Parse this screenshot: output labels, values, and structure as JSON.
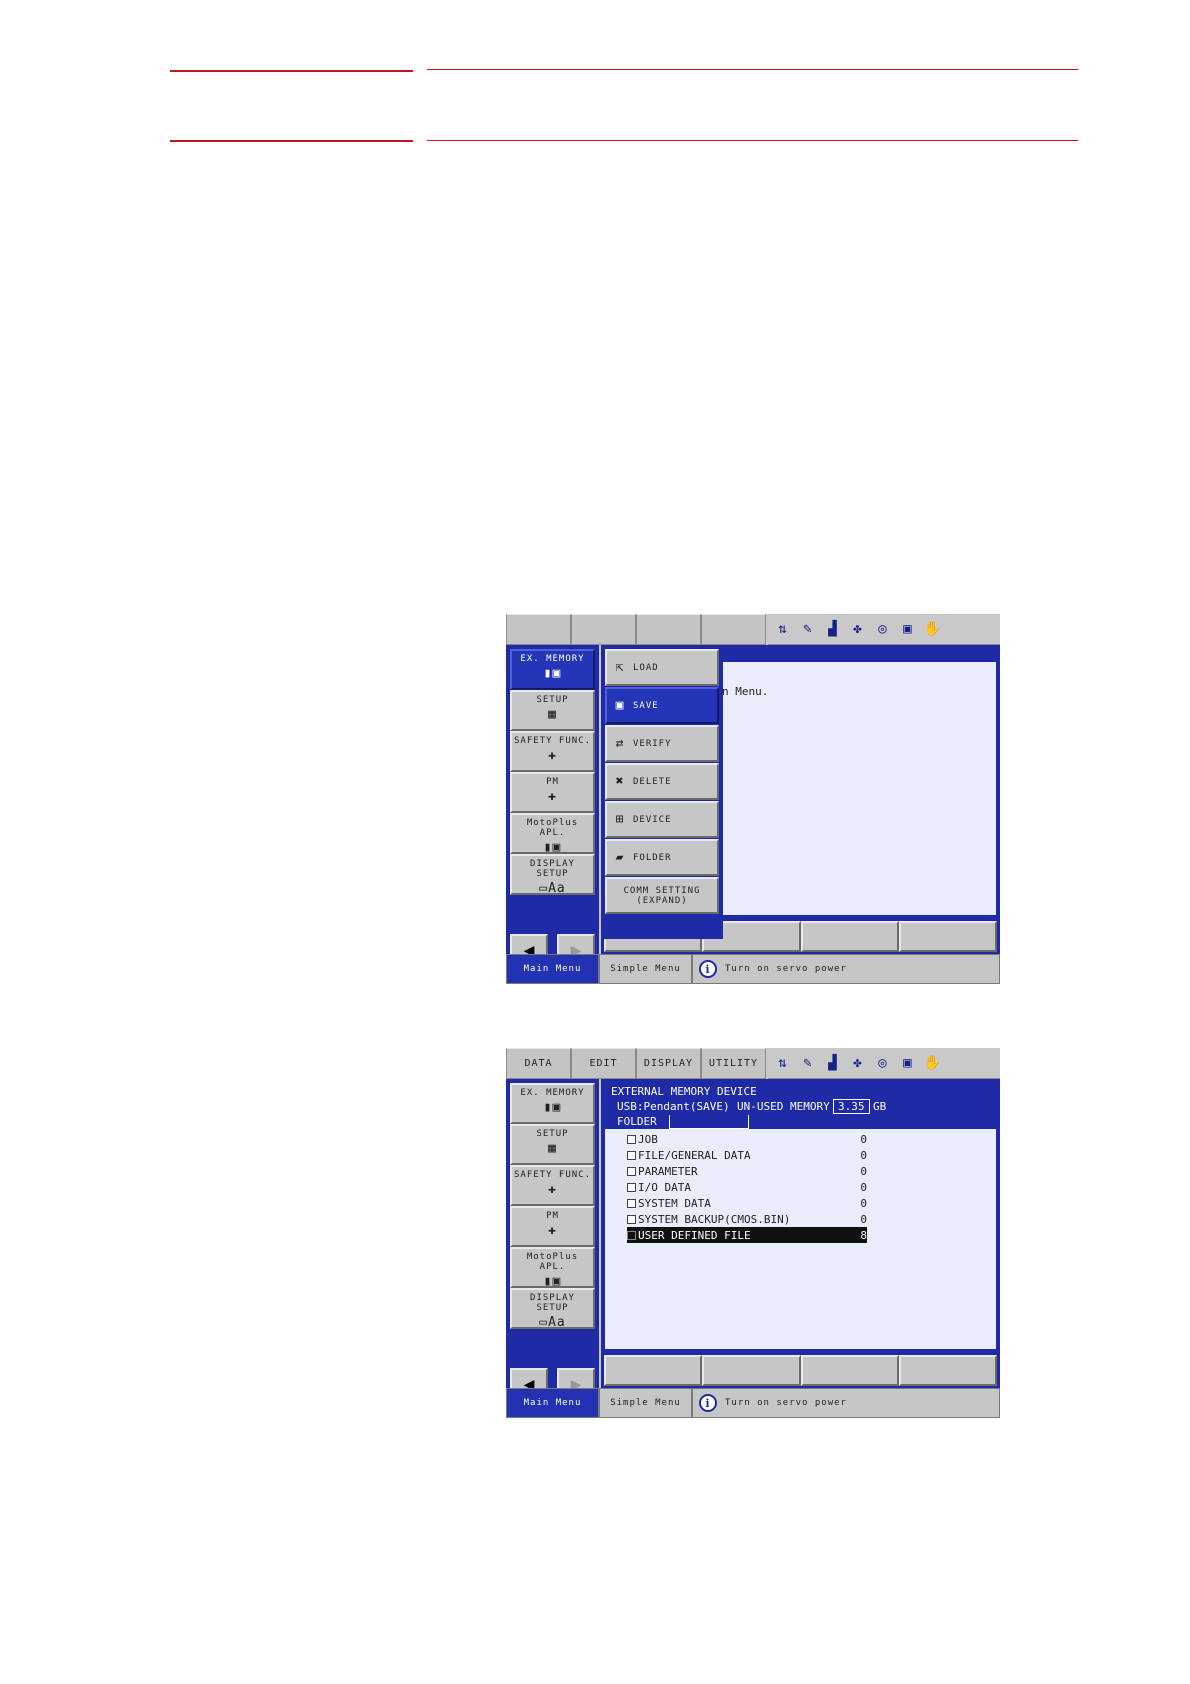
{
  "screens": [
    {
      "tabs": [
        "",
        "",
        "",
        ""
      ],
      "main_menu": [
        {
          "label": "EX. MEMORY",
          "icon": "sd-card-icon",
          "glyph": "▮▣",
          "active": true
        },
        {
          "label": "SETUP",
          "icon": "setup-icon",
          "glyph": "▦",
          "active": false
        },
        {
          "label": "SAFETY FUNC.",
          "icon": "safety-icon",
          "glyph": "✚",
          "active": false
        },
        {
          "label": "PM",
          "icon": "first-aid-kit-icon",
          "glyph": "✚",
          "active": false
        },
        {
          "label": "MotoPlus APL.",
          "icon": "sd-card-icon",
          "glyph": "▮▣",
          "active": false
        },
        {
          "label": "DISPLAY SETUP",
          "icon": "display-setup-icon",
          "glyph": "▭Aa",
          "active": false
        }
      ],
      "submenu": [
        {
          "label": "LOAD",
          "icon": "load-icon",
          "glyph": "⇱",
          "active": false
        },
        {
          "label": "SAVE",
          "icon": "save-icon",
          "glyph": "▣",
          "active": true
        },
        {
          "label": "VERIFY",
          "icon": "verify-icon",
          "glyph": "⇄",
          "active": false
        },
        {
          "label": "DELETE",
          "icon": "delete-icon",
          "glyph": "✖",
          "active": false
        },
        {
          "label": "DEVICE",
          "icon": "device-icon",
          "glyph": "⊞",
          "active": false
        },
        {
          "label": "FOLDER",
          "icon": "folder-icon",
          "glyph": "▰",
          "active": false
        },
        {
          "label": "COMM SETTING",
          "label2": "(EXPAND)",
          "icon": "",
          "glyph": "",
          "active": false
        }
      ],
      "hint": "n Menu."
    },
    {
      "tabs": [
        "DATA",
        "EDIT",
        "DISPLAY",
        "UTILITY"
      ],
      "main_menu": [
        {
          "label": "EX. MEMORY",
          "icon": "sd-card-icon",
          "glyph": "▮▣",
          "active": false
        },
        {
          "label": "SETUP",
          "icon": "setup-icon",
          "glyph": "▦",
          "active": false
        },
        {
          "label": "SAFETY FUNC.",
          "icon": "safety-icon",
          "glyph": "✚",
          "active": false
        },
        {
          "label": "PM",
          "icon": "first-aid-kit-icon",
          "glyph": "✚",
          "active": false
        },
        {
          "label": "MotoPlus APL.",
          "icon": "sd-card-icon",
          "glyph": "▮▣",
          "active": false
        },
        {
          "label": "DISPLAY SETUP",
          "icon": "display-setup-icon",
          "glyph": "▭Aa",
          "active": false
        }
      ],
      "device": {
        "title": "EXTERNAL MEMORY DEVICE",
        "target": "USB:Pendant(SAVE)",
        "unused_label": "UN-USED MEMORY",
        "unused_value": "3.35",
        "unused_unit": "GB",
        "folder_label": "FOLDER",
        "items": [
          {
            "name": "JOB",
            "count": "0",
            "selected": false
          },
          {
            "name": "FILE/GENERAL DATA",
            "count": "0",
            "selected": false
          },
          {
            "name": "PARAMETER",
            "count": "0",
            "selected": false
          },
          {
            "name": "I/O DATA",
            "count": "0",
            "selected": false
          },
          {
            "name": "SYSTEM DATA",
            "count": "0",
            "selected": false
          },
          {
            "name": "SYSTEM BACKUP(CMOS.BIN)",
            "count": "0",
            "selected": false
          },
          {
            "name": "USER DEFINED FILE",
            "count": "8",
            "selected": true
          }
        ]
      }
    }
  ],
  "status_icons": [
    {
      "name": "robot-axis-icon",
      "glyph": "⇅"
    },
    {
      "name": "edit-mode-icon",
      "glyph": "✎"
    },
    {
      "name": "signal-icon",
      "glyph": "▟"
    },
    {
      "name": "coordinate-icon",
      "glyph": "✤"
    },
    {
      "name": "tool-icon",
      "glyph": "◎"
    },
    {
      "name": "monitor-icon",
      "glyph": "▣"
    },
    {
      "name": "hand-icon",
      "glyph": "✋"
    }
  ],
  "bottom": {
    "main_menu": "Main Menu",
    "simple_menu": "Simple Menu",
    "status_message": "Turn on servo power",
    "info_glyph": "i"
  },
  "colors": {
    "rule": "#c4161c",
    "pendant_blue": "#1f2aa6",
    "client_bg": "#eaeefc"
  }
}
